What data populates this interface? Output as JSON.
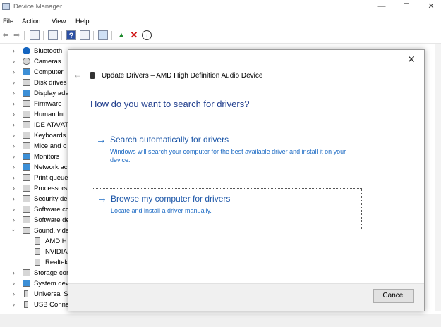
{
  "window": {
    "title": "Device Manager",
    "minimize": "—",
    "maximize": "☐",
    "close": "✕"
  },
  "menu": [
    "File",
    "Action",
    "View",
    "Help"
  ],
  "tree": [
    {
      "label": "Bluetooth",
      "icon": "bluetooth-icon",
      "expanded": false
    },
    {
      "label": "Cameras",
      "icon": "camera-icon",
      "expanded": false
    },
    {
      "label": "Computer",
      "icon": "computer-icon",
      "expanded": false
    },
    {
      "label": "Disk drives",
      "icon": "disk-drive-icon",
      "expanded": false
    },
    {
      "label": "Display ada",
      "icon": "display-adapter-icon",
      "expanded": false
    },
    {
      "label": "Firmware",
      "icon": "firmware-icon",
      "expanded": false
    },
    {
      "label": "Human Int",
      "icon": "hid-icon",
      "expanded": false
    },
    {
      "label": "IDE ATA/AT",
      "icon": "ide-controller-icon",
      "expanded": false
    },
    {
      "label": "Keyboards",
      "icon": "keyboard-icon",
      "expanded": false
    },
    {
      "label": "Mice and o",
      "icon": "mouse-icon",
      "expanded": false
    },
    {
      "label": "Monitors",
      "icon": "monitor-icon",
      "expanded": false
    },
    {
      "label": "Network ac",
      "icon": "network-adapter-icon",
      "expanded": false
    },
    {
      "label": "Print queue",
      "icon": "printer-icon",
      "expanded": false
    },
    {
      "label": "Processors",
      "icon": "processor-icon",
      "expanded": false
    },
    {
      "label": "Security de",
      "icon": "security-device-icon",
      "expanded": false
    },
    {
      "label": "Software co",
      "icon": "software-component-icon",
      "expanded": false
    },
    {
      "label": "Software de",
      "icon": "software-device-icon",
      "expanded": false
    },
    {
      "label": "Sound, vide",
      "icon": "speaker-icon",
      "expanded": true
    },
    {
      "label": "AMD H",
      "icon": "audio-device-icon",
      "child": true
    },
    {
      "label": "NVIDIA",
      "icon": "audio-device-icon",
      "child": true
    },
    {
      "label": "Realtek",
      "icon": "audio-device-icon",
      "child": true
    },
    {
      "label": "Storage cor",
      "icon": "storage-controller-icon",
      "expanded": false
    },
    {
      "label": "System dev",
      "icon": "system-device-icon",
      "expanded": false
    },
    {
      "label": "Universal S",
      "icon": "usb-icon",
      "expanded": false
    },
    {
      "label": "USB Conne",
      "icon": "usb-connector-icon",
      "expanded": false
    }
  ],
  "dialog": {
    "title": "Update Drivers – AMD High Definition Audio Device",
    "question": "How do you want to search for drivers?",
    "option_auto": {
      "title": "Search automatically for drivers",
      "description": "Windows will search your computer for the best available driver and install it on your device."
    },
    "option_browse": {
      "title": "Browse my computer for drivers",
      "description": "Locate and install a driver manually."
    },
    "cancel_label": "Cancel",
    "close": "✕",
    "back": "←",
    "arrow": "→"
  },
  "colors": {
    "link": "#1d57a8",
    "heading": "#1e3c8c"
  }
}
